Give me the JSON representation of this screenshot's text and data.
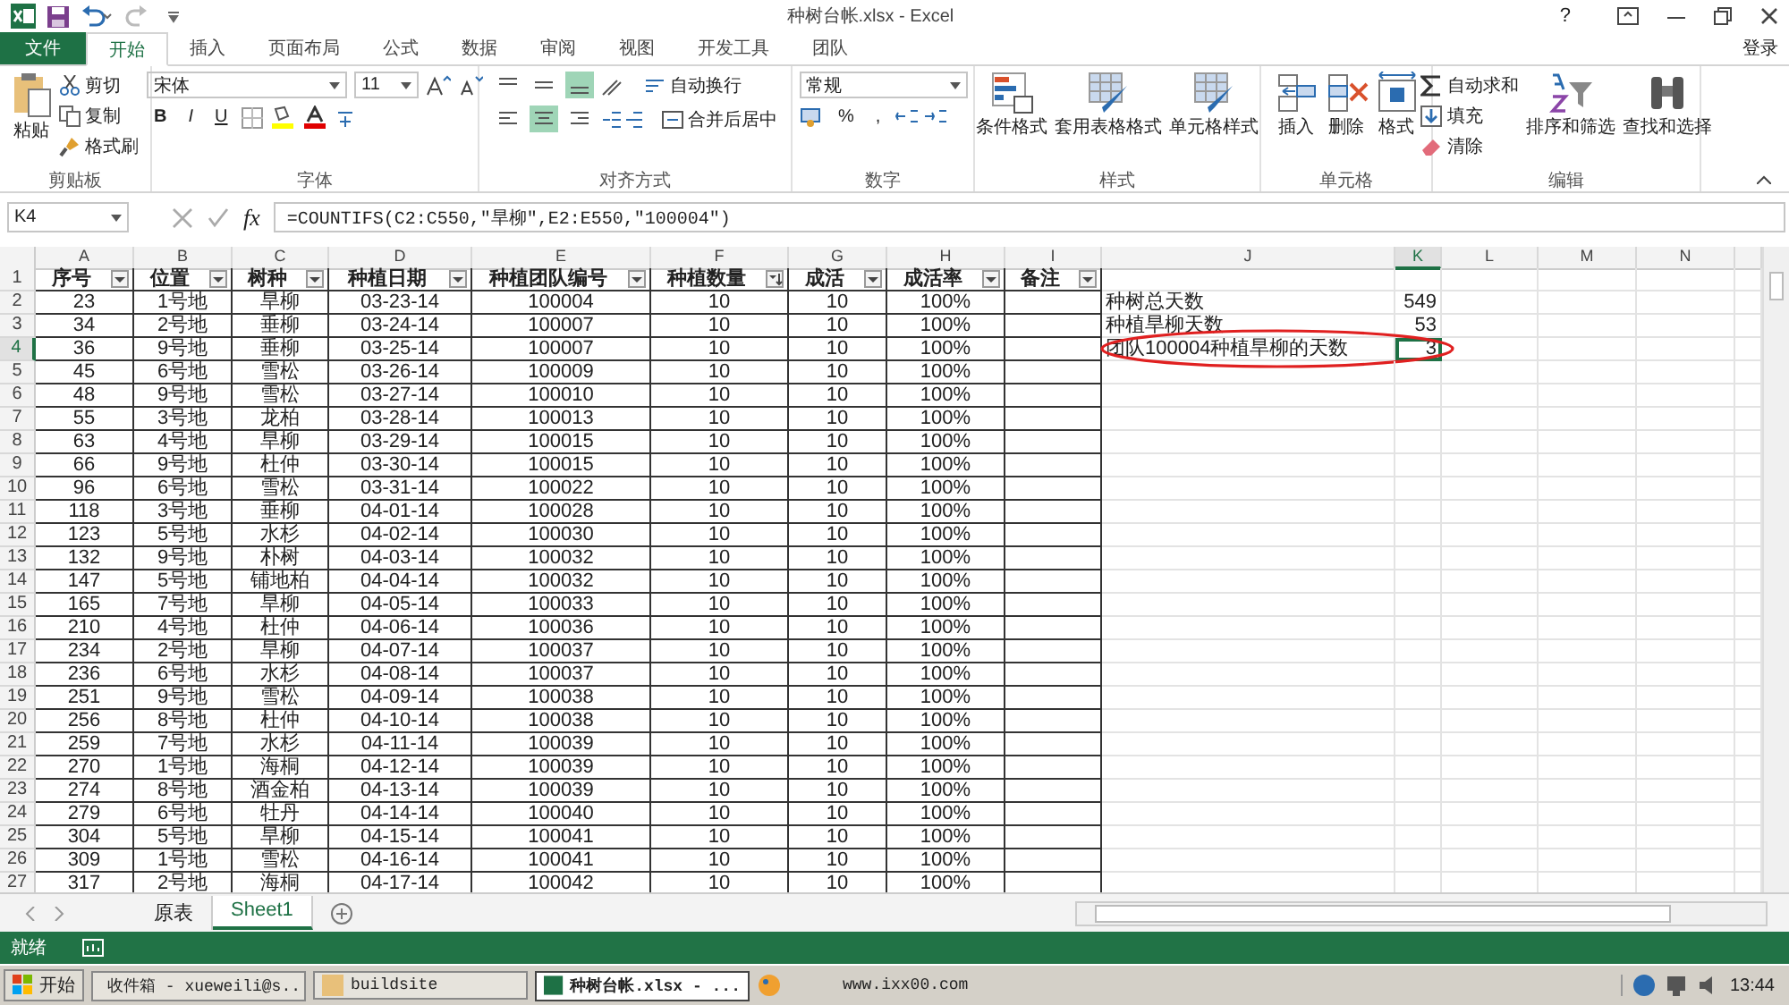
{
  "window": {
    "title": "种树台帐.xlsx - Excel",
    "help": "?"
  },
  "tabs": [
    {
      "label": "文件",
      "kind": "file",
      "selected": false
    },
    {
      "label": "开始",
      "kind": "tab",
      "selected": true
    },
    {
      "label": "插入",
      "kind": "tab",
      "selected": false
    },
    {
      "label": "页面布局",
      "kind": "tab",
      "selected": false
    },
    {
      "label": "公式",
      "kind": "tab",
      "selected": false
    },
    {
      "label": "数据",
      "kind": "tab",
      "selected": false
    },
    {
      "label": "审阅",
      "kind": "tab",
      "selected": false
    },
    {
      "label": "视图",
      "kind": "tab",
      "selected": false
    },
    {
      "label": "开发工具",
      "kind": "tab",
      "selected": false
    },
    {
      "label": "团队",
      "kind": "tab",
      "selected": false
    }
  ],
  "sign_in": "登录",
  "ribbon": [
    {
      "kind": "buttons",
      "label": "剪贴板",
      "items": [
        {
          "kind": "large",
          "label": "粘贴"
        },
        {
          "kind": "small",
          "label": "剪切"
        },
        {
          "kind": "small",
          "label": "复制"
        },
        {
          "kind": "small",
          "label": "格式刷"
        }
      ]
    },
    {
      "kind": "font",
      "label": "字体",
      "font": "宋体",
      "size": "11",
      "styles": [
        "B",
        "I",
        "U"
      ]
    },
    {
      "kind": "alignment",
      "label": "对齐方式",
      "vertical": [
        {
          "selected": false
        },
        {
          "selected": false
        },
        {
          "selected": true
        }
      ],
      "horizontal": [
        {
          "selected": false
        },
        {
          "selected": true
        },
        {
          "selected": false
        }
      ],
      "wrap": "自动换行",
      "merge": "合并后居中"
    },
    {
      "kind": "number",
      "label": "数字",
      "format": "常规",
      "percent": "%",
      "comma": ","
    },
    {
      "kind": "buttons",
      "label": "样式",
      "items": [
        {
          "kind": "large",
          "label": "条件格式"
        },
        {
          "kind": "large",
          "label": "套用表格格式"
        },
        {
          "kind": "large",
          "label": "单元格样式"
        }
      ]
    },
    {
      "kind": "buttons",
      "label": "单元格",
      "items": [
        {
          "kind": "large",
          "label": "插入"
        },
        {
          "kind": "large",
          "label": "删除"
        },
        {
          "kind": "large",
          "label": "格式"
        }
      ]
    },
    {
      "kind": "buttons",
      "label": "编辑",
      "items": [
        {
          "kind": "small",
          "label": "自动求和"
        },
        {
          "kind": "small",
          "label": "填充"
        },
        {
          "kind": "small",
          "label": "清除"
        },
        {
          "kind": "large",
          "label": "排序和筛选"
        },
        {
          "kind": "large",
          "label": "查找和选择"
        }
      ]
    }
  ],
  "formula_bar": {
    "name_box": "K4",
    "function_button": "fx",
    "formula": "=COUNTIFS(C2:C550,\"旱柳\",E2:E550,\"100004\")"
  },
  "sheet": {
    "columns": [
      {
        "letter": "A",
        "selected": false
      },
      {
        "letter": "B",
        "selected": false
      },
      {
        "letter": "C",
        "selected": false
      },
      {
        "letter": "D",
        "selected": false
      },
      {
        "letter": "E",
        "selected": false
      },
      {
        "letter": "F",
        "selected": false
      },
      {
        "letter": "G",
        "selected": false
      },
      {
        "letter": "H",
        "selected": false
      },
      {
        "letter": "I",
        "selected": false
      },
      {
        "letter": "J",
        "selected": false
      },
      {
        "letter": "K",
        "selected": true
      },
      {
        "letter": "L",
        "selected": false
      },
      {
        "letter": "M",
        "selected": false
      },
      {
        "letter": "N",
        "selected": false
      }
    ],
    "header_row_num": "1",
    "headers": [
      {
        "label": "序号",
        "sorted": false
      },
      {
        "label": "位置",
        "sorted": false
      },
      {
        "label": "树种",
        "sorted": false
      },
      {
        "label": "种植日期",
        "sorted": false
      },
      {
        "label": "种植团队编号",
        "sorted": false
      },
      {
        "label": "种植数量",
        "sorted": true
      },
      {
        "label": "成活",
        "sorted": false
      },
      {
        "label": "成活率",
        "sorted": false
      },
      {
        "label": "备注",
        "sorted": false
      }
    ],
    "rows": [
      {
        "num": "2",
        "selected": false,
        "cells": [
          "23",
          "1号地",
          "旱柳",
          "03-23-14",
          "100004",
          "10",
          "10",
          "100%"
        ],
        "summary": {
          "label": "种树总天数",
          "value": "549",
          "selected": false,
          "circled": false
        }
      },
      {
        "num": "3",
        "selected": false,
        "cells": [
          "34",
          "2号地",
          "垂柳",
          "03-24-14",
          "100007",
          "10",
          "10",
          "100%"
        ],
        "summary": {
          "label": "种植旱柳天数",
          "value": "53",
          "selected": false,
          "circled": false
        }
      },
      {
        "num": "4",
        "selected": true,
        "cells": [
          "36",
          "9号地",
          "垂柳",
          "03-25-14",
          "100007",
          "10",
          "10",
          "100%"
        ],
        "summary": {
          "label": "团队100004种植旱柳的天数",
          "value": "3",
          "selected": true,
          "circled": true
        }
      },
      {
        "num": "5",
        "selected": false,
        "cells": [
          "45",
          "6号地",
          "雪松",
          "03-26-14",
          "100009",
          "10",
          "10",
          "100%"
        ]
      },
      {
        "num": "6",
        "selected": false,
        "cells": [
          "48",
          "9号地",
          "雪松",
          "03-27-14",
          "100010",
          "10",
          "10",
          "100%"
        ]
      },
      {
        "num": "7",
        "selected": false,
        "cells": [
          "55",
          "3号地",
          "龙柏",
          "03-28-14",
          "100013",
          "10",
          "10",
          "100%"
        ]
      },
      {
        "num": "8",
        "selected": false,
        "cells": [
          "63",
          "4号地",
          "旱柳",
          "03-29-14",
          "100015",
          "10",
          "10",
          "100%"
        ]
      },
      {
        "num": "9",
        "selected": false,
        "cells": [
          "66",
          "9号地",
          "杜仲",
          "03-30-14",
          "100015",
          "10",
          "10",
          "100%"
        ]
      },
      {
        "num": "10",
        "selected": false,
        "cells": [
          "96",
          "6号地",
          "雪松",
          "03-31-14",
          "100022",
          "10",
          "10",
          "100%"
        ]
      },
      {
        "num": "11",
        "selected": false,
        "cells": [
          "118",
          "3号地",
          "垂柳",
          "04-01-14",
          "100028",
          "10",
          "10",
          "100%"
        ]
      },
      {
        "num": "12",
        "selected": false,
        "cells": [
          "123",
          "5号地",
          "水杉",
          "04-02-14",
          "100030",
          "10",
          "10",
          "100%"
        ]
      },
      {
        "num": "13",
        "selected": false,
        "cells": [
          "132",
          "9号地",
          "朴树",
          "04-03-14",
          "100032",
          "10",
          "10",
          "100%"
        ]
      },
      {
        "num": "14",
        "selected": false,
        "cells": [
          "147",
          "5号地",
          "铺地柏",
          "04-04-14",
          "100032",
          "10",
          "10",
          "100%"
        ]
      },
      {
        "num": "15",
        "selected": false,
        "cells": [
          "165",
          "7号地",
          "旱柳",
          "04-05-14",
          "100033",
          "10",
          "10",
          "100%"
        ]
      },
      {
        "num": "16",
        "selected": false,
        "cells": [
          "210",
          "4号地",
          "杜仲",
          "04-06-14",
          "100036",
          "10",
          "10",
          "100%"
        ]
      },
      {
        "num": "17",
        "selected": false,
        "cells": [
          "234",
          "2号地",
          "旱柳",
          "04-07-14",
          "100037",
          "10",
          "10",
          "100%"
        ]
      },
      {
        "num": "18",
        "selected": false,
        "cells": [
          "236",
          "6号地",
          "水杉",
          "04-08-14",
          "100037",
          "10",
          "10",
          "100%"
        ]
      },
      {
        "num": "19",
        "selected": false,
        "cells": [
          "251",
          "9号地",
          "雪松",
          "04-09-14",
          "100038",
          "10",
          "10",
          "100%"
        ]
      },
      {
        "num": "20",
        "selected": false,
        "cells": [
          "256",
          "8号地",
          "杜仲",
          "04-10-14",
          "100038",
          "10",
          "10",
          "100%"
        ]
      },
      {
        "num": "21",
        "selected": false,
        "cells": [
          "259",
          "7号地",
          "水杉",
          "04-11-14",
          "100039",
          "10",
          "10",
          "100%"
        ]
      },
      {
        "num": "22",
        "selected": false,
        "cells": [
          "270",
          "1号地",
          "海桐",
          "04-12-14",
          "100039",
          "10",
          "10",
          "100%"
        ]
      },
      {
        "num": "23",
        "selected": false,
        "cells": [
          "274",
          "8号地",
          "酒金柏",
          "04-13-14",
          "100039",
          "10",
          "10",
          "100%"
        ]
      },
      {
        "num": "24",
        "selected": false,
        "cells": [
          "279",
          "6号地",
          "牡丹",
          "04-14-14",
          "100040",
          "10",
          "10",
          "100%"
        ]
      },
      {
        "num": "25",
        "selected": false,
        "cells": [
          "304",
          "5号地",
          "旱柳",
          "04-15-14",
          "100041",
          "10",
          "10",
          "100%"
        ]
      },
      {
        "num": "26",
        "selected": false,
        "cells": [
          "309",
          "1号地",
          "雪松",
          "04-16-14",
          "100041",
          "10",
          "10",
          "100%"
        ]
      },
      {
        "num": "27",
        "selected": false,
        "cells": [
          "317",
          "2号地",
          "海桐",
          "04-17-14",
          "100042",
          "10",
          "10",
          "100%"
        ]
      }
    ]
  },
  "sheet_tabs": [
    {
      "label": "原表",
      "selected": false
    },
    {
      "label": "Sheet1",
      "selected": true
    }
  ],
  "status_bar": {
    "text": "就绪"
  },
  "taskbar": {
    "start": "开始",
    "tasks": [
      {
        "label": "收件箱 - xueweili@s...",
        "selected": false
      },
      {
        "label": "buildsite",
        "selected": false
      },
      {
        "label": "种树台帐.xlsx - ...",
        "selected": true
      }
    ],
    "url": "www.ixx00.com",
    "clock": "13:44"
  }
}
